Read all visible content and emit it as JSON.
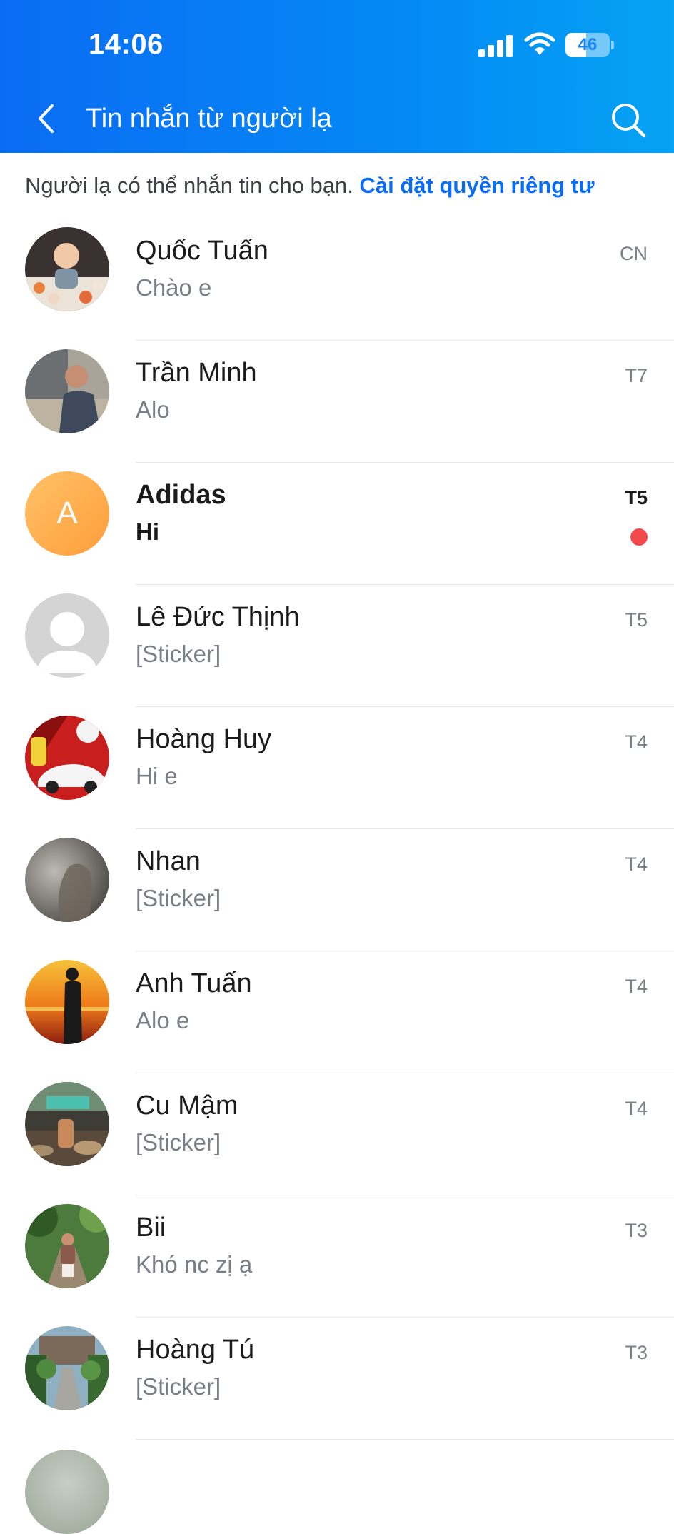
{
  "status_bar": {
    "time": "14:06",
    "battery": "46",
    "battery_level": 0.46
  },
  "header": {
    "title": "Tin nhắn từ người lạ"
  },
  "privacy": {
    "text": "Người lạ có thể nhắn tin cho bạn.",
    "link": "Cài đặt quyền riêng tư"
  },
  "conversations": [
    {
      "name": "Quốc Tuấn",
      "message": "Chào e",
      "time": "CN",
      "unread": false,
      "avatar": "photo-baby"
    },
    {
      "name": "Trần Minh",
      "message": "Alo",
      "time": "T7",
      "unread": false,
      "avatar": "photo-man"
    },
    {
      "name": "Adidas",
      "message": "Hi",
      "time": "T5",
      "unread": true,
      "avatar_letter": "A"
    },
    {
      "name": "Lê Đức Thịnh",
      "message": "[Sticker]",
      "time": "T5",
      "unread": false,
      "avatar": "default-user"
    },
    {
      "name": "Hoàng Huy",
      "message": "Hi e",
      "time": "T4",
      "unread": false,
      "avatar": "photo-car"
    },
    {
      "name": "Nhan",
      "message": "[Sticker]",
      "time": "T4",
      "unread": false,
      "avatar": "photo-gray"
    },
    {
      "name": "Anh Tuấn",
      "message": "Alo e",
      "time": "T4",
      "unread": false,
      "avatar": "photo-sunset"
    },
    {
      "name": "Cu Mậm",
      "message": "[Sticker]",
      "time": "T4",
      "unread": false,
      "avatar": "photo-cafe"
    },
    {
      "name": "Bii",
      "message": "Khó nc zị ạ",
      "time": "T3",
      "unread": false,
      "avatar": "photo-bridge"
    },
    {
      "name": "Hoàng Tú",
      "message": "[Sticker]",
      "time": "T3",
      "unread": false,
      "avatar": "photo-garden"
    }
  ],
  "colors": {
    "header": "#0a6cf3",
    "link": "#0a6cf3",
    "unread_dot": "#f04a4c",
    "letter_avatar": "#ffa94a"
  }
}
